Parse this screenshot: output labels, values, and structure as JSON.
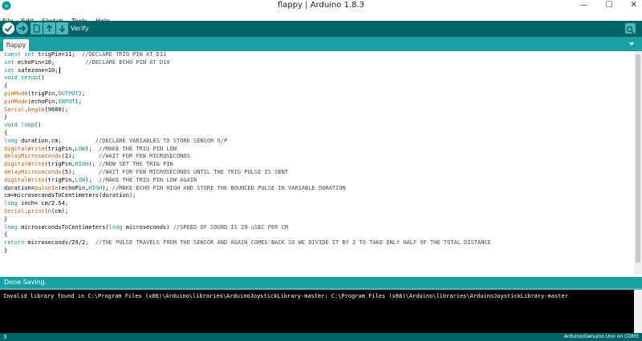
{
  "window": {
    "title": "flappy | Arduino 1.8.3",
    "controls": [
      "—",
      "☐",
      "✕"
    ]
  },
  "menu": [
    "File",
    "Edit",
    "Sketch",
    "Tools",
    "Help"
  ],
  "toolbar": {
    "hover_label": "Verify",
    "buttons": [
      "verify-icon",
      "upload-icon",
      "new-icon",
      "open-icon",
      "save-icon"
    ],
    "serial_monitor_icon": "magnifier-icon"
  },
  "tabs": [
    "flappy"
  ],
  "tab_menu_icon": "dropdown-arrow-icon",
  "editor": {
    "lines": [
      [
        {
          "t": "const int",
          "c": "kw"
        },
        {
          "t": " trigPin=11;  "
        },
        {
          "t": "//DECLARE TRIG PIN AT D11",
          "c": "cm"
        }
      ],
      [
        {
          "t": "int",
          "c": "kw"
        },
        {
          "t": " echoPin=10;         "
        },
        {
          "t": "//DECLARE ECHO PIN AT D10",
          "c": "cm"
        }
      ],
      [
        {
          "t": "int",
          "c": "kw"
        },
        {
          "t": " safezone=10;"
        }
      ],
      [
        {
          "t": "void",
          "c": "kw"
        },
        {
          "t": " "
        },
        {
          "t": "setup",
          "c": "kw"
        },
        {
          "t": "()"
        }
      ],
      [
        {
          "t": "{"
        }
      ],
      [
        {
          "t": "pinMode",
          "c": "fn"
        },
        {
          "t": "(trigPin,"
        },
        {
          "t": "OUTPUT",
          "c": "kw"
        },
        {
          "t": ");"
        }
      ],
      [
        {
          "t": "pinMode",
          "c": "fn"
        },
        {
          "t": "(echoPin,"
        },
        {
          "t": "INPUT",
          "c": "kw"
        },
        {
          "t": ");"
        }
      ],
      [
        {
          "t": "Serial",
          "c": "fn"
        },
        {
          "t": "."
        },
        {
          "t": "begin",
          "c": "fn"
        },
        {
          "t": "(9600);"
        }
      ],
      [
        {
          "t": "}"
        }
      ],
      [
        {
          "t": "void",
          "c": "kw"
        },
        {
          "t": " "
        },
        {
          "t": "loop",
          "c": "kw"
        },
        {
          "t": "()"
        }
      ],
      [
        {
          "t": "{"
        }
      ],
      [
        {
          "t": "long",
          "c": "kw"
        },
        {
          "t": " duration,cm;          "
        },
        {
          "t": "//DECLARE VARIABLES TO STORE SENSOR O/P",
          "c": "cm"
        }
      ],
      [
        {
          "t": "digitalWrite",
          "c": "fn"
        },
        {
          "t": "(trigPin,"
        },
        {
          "t": "LOW",
          "c": "kw"
        },
        {
          "t": ");  "
        },
        {
          "t": "//MAKE THE TRIG PIN LOW",
          "c": "cm"
        }
      ],
      [
        {
          "t": "delayMicroseconds",
          "c": "fn"
        },
        {
          "t": "(2);       "
        },
        {
          "t": "//WAIT FOR FEW MICROSECONDS",
          "c": "cm"
        }
      ],
      [
        {
          "t": "digitalWrite",
          "c": "fn"
        },
        {
          "t": "(trigPin,"
        },
        {
          "t": "HIGH",
          "c": "kw"
        },
        {
          "t": "); "
        },
        {
          "t": "//NOW SET THE TRIG PIN",
          "c": "cm"
        }
      ],
      [
        {
          "t": "delayMicroseconds",
          "c": "fn"
        },
        {
          "t": "(5);       "
        },
        {
          "t": "//WAIT FOR FEW MICROSECONDS UNTIL THE TRIG PULSE IS SENT",
          "c": "cm"
        }
      ],
      [
        {
          "t": "digitalWrite",
          "c": "fn"
        },
        {
          "t": "(trigPin,"
        },
        {
          "t": "LOW",
          "c": "kw"
        },
        {
          "t": ");  "
        },
        {
          "t": "//MAKE THE TRIG PIN LOW AGAIN",
          "c": "cm"
        }
      ],
      [
        {
          "t": "duration="
        },
        {
          "t": "pulseIn",
          "c": "fn"
        },
        {
          "t": "(echoPin,"
        },
        {
          "t": "HIGH",
          "c": "kw"
        },
        {
          "t": "); "
        },
        {
          "t": "//MAKE ECHO PIN HIGH AND STORE THE BOUNCED PULSE IN VARIABLE DURATION",
          "c": "cm"
        }
      ],
      [
        {
          "t": "cm=microsecondsToCentimeters(duration);"
        }
      ],
      [
        {
          "t": "long",
          "c": "kw"
        },
        {
          "t": " inch= cm/2.54;"
        }
      ],
      [
        {
          "t": "Serial",
          "c": "fn"
        },
        {
          "t": "."
        },
        {
          "t": "println",
          "c": "fn"
        },
        {
          "t": "(cm);"
        }
      ],
      [
        {
          "t": "}"
        }
      ],
      [
        {
          "t": "long",
          "c": "kw"
        },
        {
          "t": " microsecondsToCentimeters("
        },
        {
          "t": "long",
          "c": "kw"
        },
        {
          "t": " microseconds) "
        },
        {
          "t": "//SPEED OF SOUND IS 29 uSEC PER CM",
          "c": "cm"
        }
      ],
      [
        {
          "t": "{"
        }
      ],
      [
        {
          "t": "return",
          "c": "kw"
        },
        {
          "t": " microseconds/29/2;  "
        },
        {
          "t": "//THE PULSE TRAVELS FROM THE SENSOR AND AGAIN COMES BACK SO WE DIVIDE IT BY 2 TO TAKE ONLY HALF OF THE TOTAL DISTANCE",
          "c": "cm"
        }
      ],
      [
        {
          "t": "}"
        }
      ]
    ]
  },
  "status": "Done Saving.",
  "console": "Invalid library found in C:\\Program Files (x86)\\Arduino\\libraries\\ArduinoJoystickLibrary-master: C:\\Program Files (x86)\\Arduino\\libraries\\ArduinoJoystickLibrary-master",
  "footer": {
    "line": "3",
    "board": "Arduino/Genuino Uno on COM3"
  },
  "colors": {
    "toolbar": "#006468",
    "tabbar": "#17a1a5",
    "keyword": "#00979c",
    "function": "#d35400",
    "comment": "#434f54"
  }
}
